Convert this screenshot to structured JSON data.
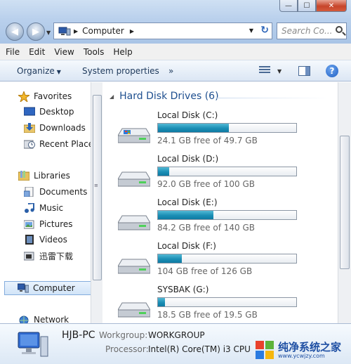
{
  "window": {
    "minimize_label": "—",
    "maximize_label": "☐",
    "close_label": "✕"
  },
  "nav": {
    "back_glyph": "◀",
    "forward_glyph": "▶",
    "dropdown_glyph": "▼"
  },
  "address": {
    "separator": "▶",
    "crumb": "Computer",
    "trailing_separator": "▶",
    "dropdown_glyph": "▼",
    "refresh_glyph": "↻"
  },
  "search": {
    "placeholder": "Search Co..."
  },
  "menu": [
    "File",
    "Edit",
    "View",
    "Tools",
    "Help"
  ],
  "toolbar": {
    "organize_label": "Organize",
    "system_properties_label": "System properties",
    "more_label": "»",
    "dropdown_glyph": "▼",
    "help_label": "?"
  },
  "navpane": {
    "items": [
      {
        "label": "Favorites",
        "icon": "star-icon"
      },
      {
        "label": "Desktop",
        "icon": "desktop-icon"
      },
      {
        "label": "Downloads",
        "icon": "downloads-icon"
      },
      {
        "label": "Recent Place",
        "icon": "recent-places-icon"
      },
      {
        "label": "Libraries",
        "icon": "libraries-icon"
      },
      {
        "label": "Documents",
        "icon": "documents-icon"
      },
      {
        "label": "Music",
        "icon": "music-icon"
      },
      {
        "label": "Pictures",
        "icon": "pictures-icon"
      },
      {
        "label": "Videos",
        "icon": "videos-icon"
      },
      {
        "label": "迅雷下载",
        "icon": "folder-icon"
      },
      {
        "label": "Computer",
        "icon": "computer-icon"
      },
      {
        "label": "Network",
        "icon": "network-icon"
      }
    ],
    "selected": "Computer"
  },
  "content": {
    "group_title": "Hard Disk Drives (6)",
    "group_caret": "◢",
    "drives": [
      {
        "name": "Local Disk (C:)",
        "free_text": "24.1 GB free of 49.7 GB",
        "used_fraction": 0.515,
        "system": true
      },
      {
        "name": "Local Disk (D:)",
        "free_text": "92.0 GB free of 100 GB",
        "used_fraction": 0.08,
        "system": false
      },
      {
        "name": "Local Disk (E:)",
        "free_text": "84.2 GB free of 140 GB",
        "used_fraction": 0.4,
        "system": false
      },
      {
        "name": "Local Disk (F:)",
        "free_text": "104 GB free of 126 GB",
        "used_fraction": 0.175,
        "system": false
      },
      {
        "name": "SYSBAK (G:)",
        "free_text": "18.5 GB free of 19.5 GB",
        "used_fraction": 0.05,
        "system": false
      }
    ]
  },
  "details": {
    "pc_name": "HJB-PC",
    "workgroup_label": "Workgroup:",
    "workgroup_value": "WORKGROUP",
    "processor_label": "Processor:",
    "processor_value": "Intel(R) Core(TM) i3 CPU"
  },
  "watermark": {
    "title": "纯净系统之家",
    "url": "www.ycwjzy.com"
  },
  "colors": {
    "drive_fill": "#1b8eb5",
    "group_title": "#1e4f8f",
    "selection_border": "#84acdd"
  }
}
